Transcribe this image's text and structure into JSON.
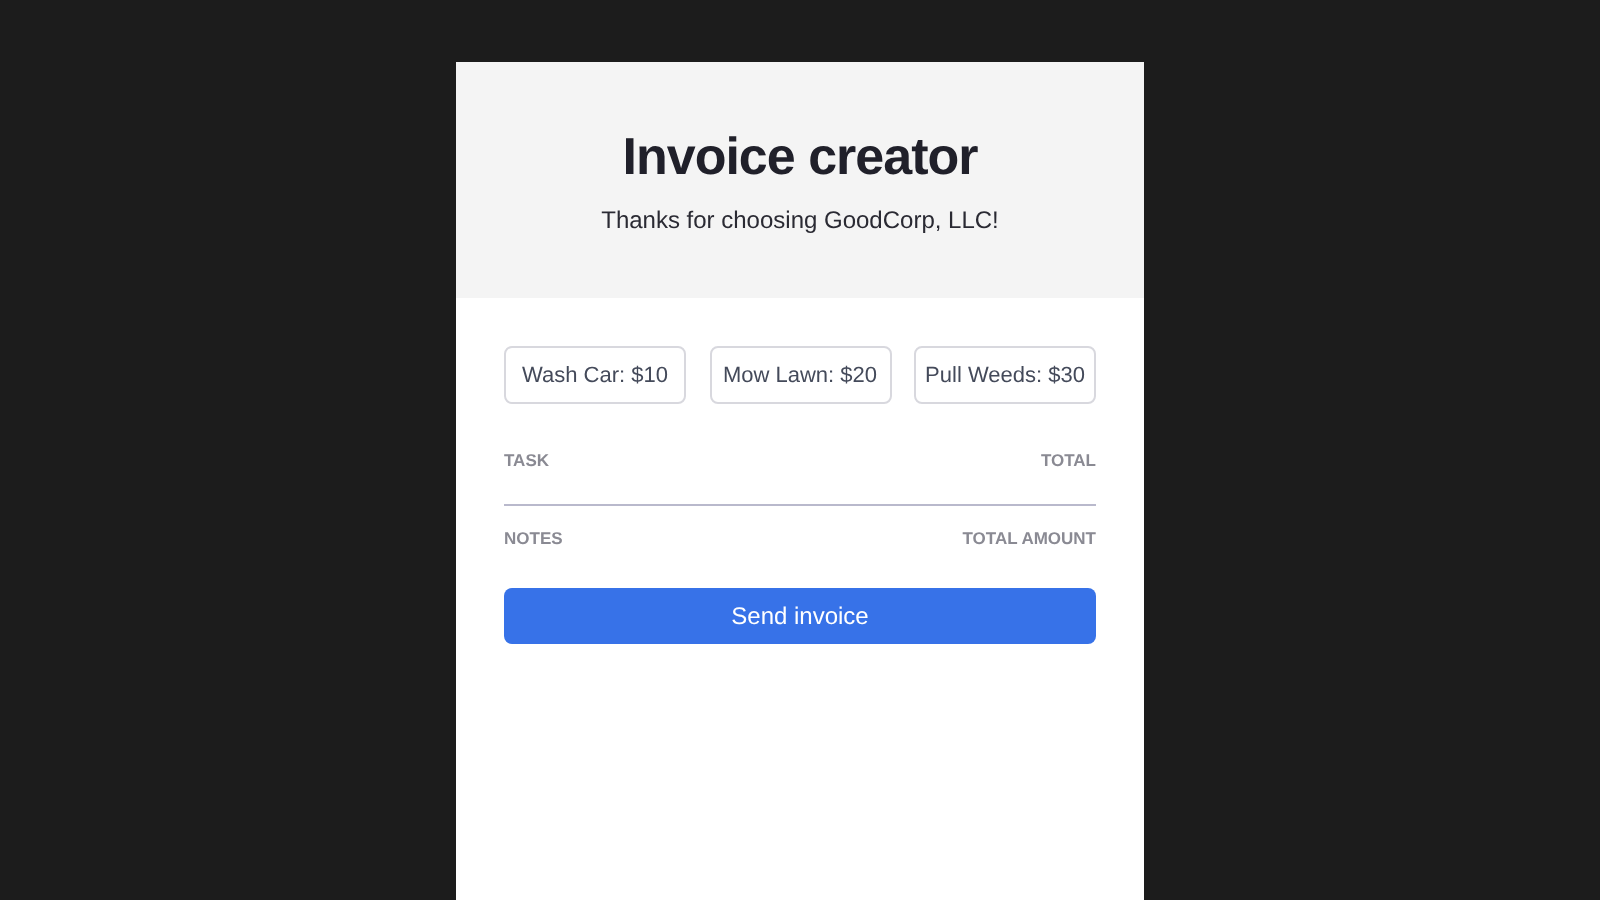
{
  "header": {
    "title": "Invoice creator",
    "subtitle": "Thanks for choosing GoodCorp, LLC!"
  },
  "services": [
    "Wash Car: $10",
    "Mow Lawn: $20",
    "Pull Weeds: $30"
  ],
  "table": {
    "columns": [
      "TASK",
      "TOTAL"
    ]
  },
  "footer": {
    "notes_label": "NOTES",
    "total_label": "TOTAL AMOUNT"
  },
  "submit": "Send invoice"
}
